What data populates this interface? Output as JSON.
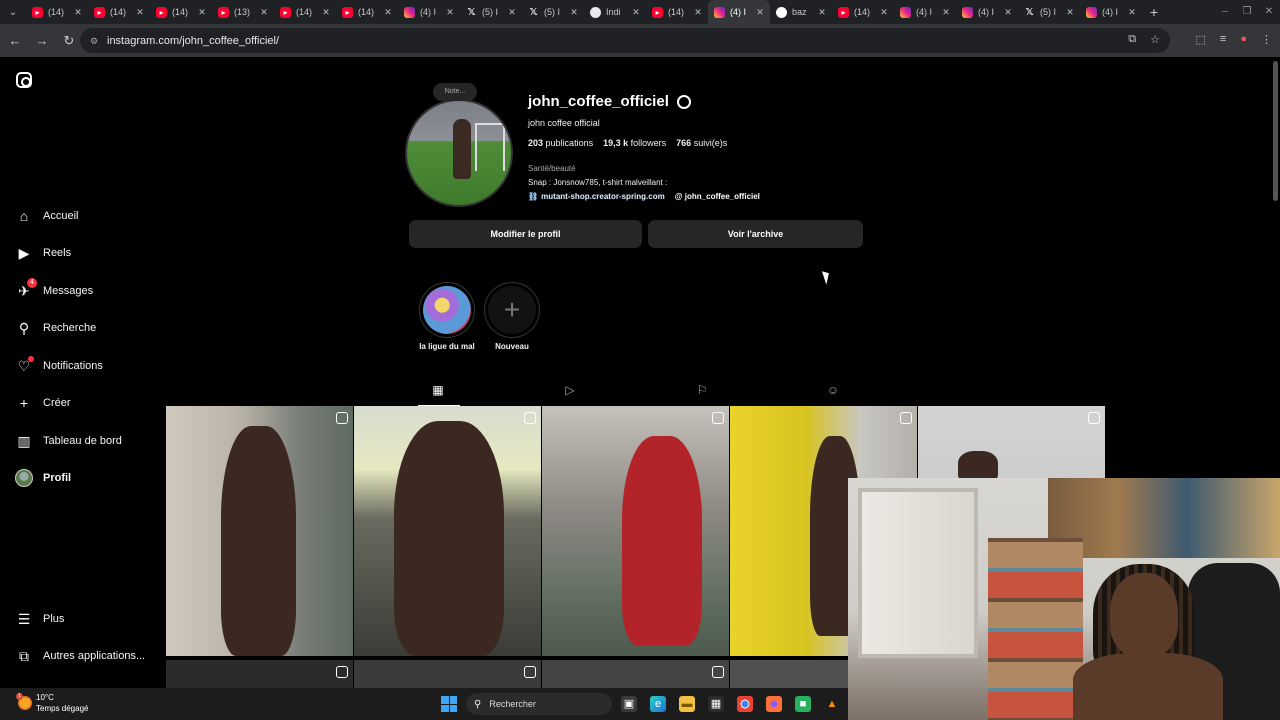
{
  "browser": {
    "tabs": [
      {
        "icon": "youtube-icon",
        "label": "(14)"
      },
      {
        "icon": "youtube-icon",
        "label": "(14)"
      },
      {
        "icon": "youtube-icon",
        "label": "(14)"
      },
      {
        "icon": "youtube-icon",
        "label": "(13)"
      },
      {
        "icon": "youtube-icon",
        "label": "(14)"
      },
      {
        "icon": "youtube-icon",
        "label": "(14)"
      },
      {
        "icon": "instagram-icon",
        "label": "(4) I"
      },
      {
        "icon": "x-icon",
        "label": "(5) I"
      },
      {
        "icon": "x-icon",
        "label": "(5) I"
      },
      {
        "icon": "globe-icon",
        "label": "Indi"
      },
      {
        "icon": "youtube-icon",
        "label": "(14)"
      },
      {
        "icon": "instagram-icon",
        "label": "(4) I"
      },
      {
        "icon": "google-icon",
        "label": "baz"
      },
      {
        "icon": "youtube-icon",
        "label": "(14)"
      },
      {
        "icon": "instagram-icon",
        "label": "(4) I"
      },
      {
        "icon": "instagram-icon",
        "label": "(4) I"
      },
      {
        "icon": "x-icon",
        "label": "(5) I"
      },
      {
        "icon": "instagram-icon",
        "label": "(4) I"
      }
    ],
    "url": "instagram.com/john_coffee_officiel/"
  },
  "sidebar": {
    "items": [
      {
        "name": "accueil",
        "icon": "home-icon",
        "label": "Accueil"
      },
      {
        "name": "reels",
        "icon": "reels-icon",
        "label": "Reels"
      },
      {
        "name": "messages",
        "icon": "messenger-icon",
        "label": "Messages",
        "badge": "4"
      },
      {
        "name": "recherche",
        "icon": "search-icon",
        "label": "Recherche"
      },
      {
        "name": "notifications",
        "icon": "heart-icon",
        "label": "Notifications"
      },
      {
        "name": "creer",
        "icon": "plus-icon",
        "label": "Créer"
      },
      {
        "name": "tableau-de-bord",
        "icon": "chart-icon",
        "label": "Tableau de bord"
      },
      {
        "name": "profil",
        "icon": "avatar-icon",
        "label": "Profil"
      },
      {
        "name": "plus",
        "icon": "menu-icon",
        "label": "Plus"
      },
      {
        "name": "autres-applications",
        "icon": "apps-icon",
        "label": "Autres applications..."
      }
    ]
  },
  "profile": {
    "note": "Note...",
    "username": "john_coffee_officiel",
    "full_name": "john coffee official",
    "publications_count": "203",
    "publications_label": "publications",
    "followers_count": "19,3 k",
    "followers_label": "followers",
    "following_count": "766",
    "following_label": "suivi(e)s",
    "category": "Santé/beauté",
    "bio": "Snap : Jonsnow785, t-shirt malveillant :",
    "link": "mutant-shop.creator-spring.com",
    "threads": "john_coffee_officiel",
    "edit_button": "Modifier le profil",
    "archive_button": "Voir l'archive"
  },
  "highlights": [
    {
      "label": "la ligue du mal"
    },
    {
      "label": "Nouveau"
    }
  ],
  "content_tabs": [
    "grid-icon",
    "reels-icon",
    "bookmark-icon",
    "tagged-icon"
  ],
  "taskbar": {
    "temperature": "10°C",
    "weather": "Temps dégagé",
    "weather_badge": "1",
    "search_placeholder": "Rechercher"
  }
}
